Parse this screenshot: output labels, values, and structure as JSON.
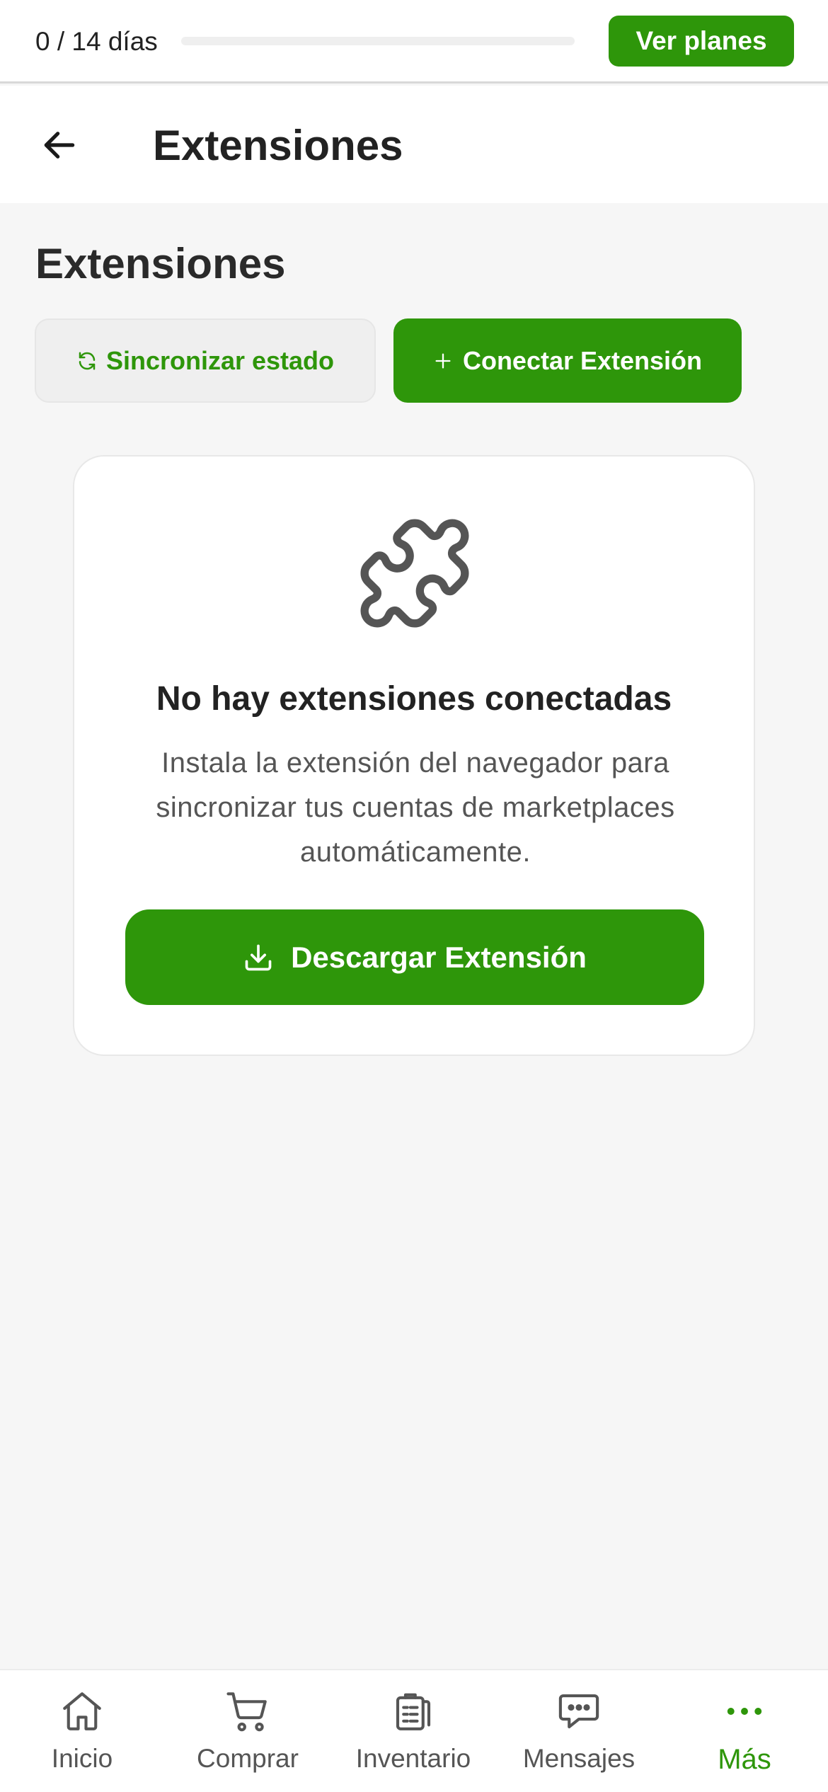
{
  "trial": {
    "label": "0 / 14 días",
    "progress_fraction": 0,
    "button_label": "Ver planes"
  },
  "header": {
    "back_icon": "arrow-left-icon",
    "title": "Extensiones"
  },
  "main": {
    "section_title": "Extensiones",
    "sync_button": {
      "icon": "refresh-icon",
      "label": "Sincronizar estado"
    },
    "connect_button": {
      "icon": "plus-icon",
      "label": "Conectar Extensión"
    },
    "empty_state": {
      "icon": "puzzle-icon",
      "title": "No hay extensiones conectadas",
      "description": "Instala la extensión del navegador para sincronizar tus cuentas de marketplaces automáticamente.",
      "download_button": {
        "icon": "download-icon",
        "label": "Descargar Extensión"
      }
    }
  },
  "bottom_nav": {
    "items": [
      {
        "label": "Inicio",
        "icon": "home-icon"
      },
      {
        "label": "Comprar",
        "icon": "cart-icon"
      },
      {
        "label": "Inventario",
        "icon": "clipboard-icon"
      },
      {
        "label": "Mensajes",
        "icon": "chat-icon"
      },
      {
        "label": "Más",
        "icon": "more-icon",
        "active": true
      }
    ]
  },
  "colors": {
    "accent": "#2e960a",
    "background": "#f6f6f6",
    "text": "#222222",
    "muted_text": "#555555"
  }
}
